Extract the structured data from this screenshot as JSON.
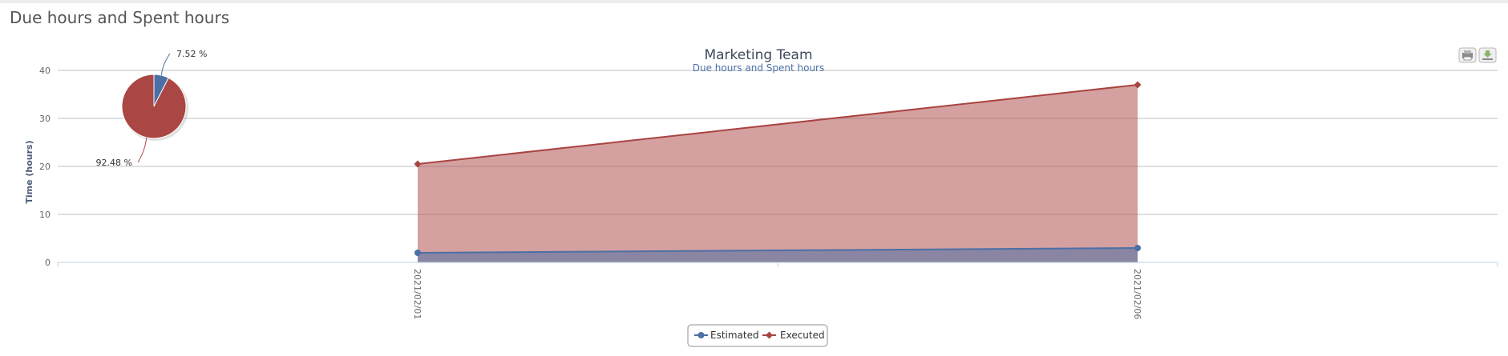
{
  "panel": {
    "title": "Due hours and Spent hours"
  },
  "export": {
    "print_icon": "printer-icon",
    "download_icon": "download-icon"
  },
  "chart_data": [
    {
      "type": "area",
      "title": "Marketing Team",
      "subtitle": "Due hours and Spent hours",
      "ylabel": "Time (hours)",
      "xlabel": "",
      "categories": [
        "2021/02/01",
        "2021/02/06"
      ],
      "ylim": [
        0,
        40
      ],
      "yticks": [
        0,
        10,
        20,
        30,
        40
      ],
      "grid": true,
      "legend_position": "bottom-center",
      "series": [
        {
          "name": "Estimated",
          "color": "#4c6fa5",
          "marker": "circle",
          "values": [
            2,
            3
          ]
        },
        {
          "name": "Executed",
          "color": "#a94442",
          "marker": "diamond",
          "values": [
            20.5,
            37
          ]
        }
      ]
    },
    {
      "type": "pie",
      "slices": [
        {
          "value": 7.52,
          "label": "7.52 %",
          "color": "#4c6fa5"
        },
        {
          "value": 92.48,
          "label": "92.48 %",
          "color": "#aa4643"
        }
      ]
    }
  ]
}
